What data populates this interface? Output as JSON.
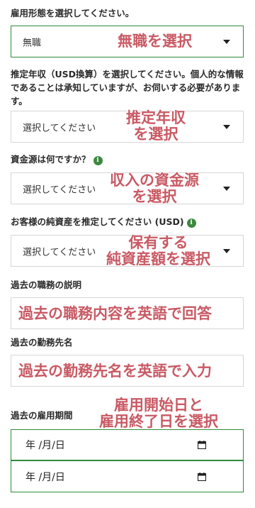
{
  "employment_status": {
    "label": "雇用形態を選択してください。",
    "value": "無職",
    "annotation": "無職を選択"
  },
  "income": {
    "label": "推定年収（USD換算）を選択してください。個人的な情報であることは承知していますが、お伺いする必要があります。",
    "placeholder": "選択してください",
    "annotation": "推定年収\nを選択"
  },
  "source_of_funds": {
    "label": "資金源は何ですか？",
    "placeholder": "選択してください",
    "annotation": "収入の資金源\nを選択"
  },
  "net_worth": {
    "label": "お客様の純資産を推定してください (USD)",
    "placeholder": "選択してください",
    "annotation": "保有する\n純資産額を選択"
  },
  "job_description": {
    "label": "過去の職務の説明",
    "annotation": "過去の職務内容を英語で回答"
  },
  "employer_name": {
    "label": "過去の勤務先名",
    "annotation": "過去の勤務先名を英語で入力"
  },
  "employment_period": {
    "label": "過去の雇用期間",
    "annotation": "雇用開始日と\n雇用終了日を選択",
    "start_value": "年 /月/日",
    "end_value": "年 /月/日"
  },
  "colors": {
    "active_border": "#2e8b3a",
    "annotation_text": "#c95a64",
    "info_icon": "#3b8a3e"
  }
}
